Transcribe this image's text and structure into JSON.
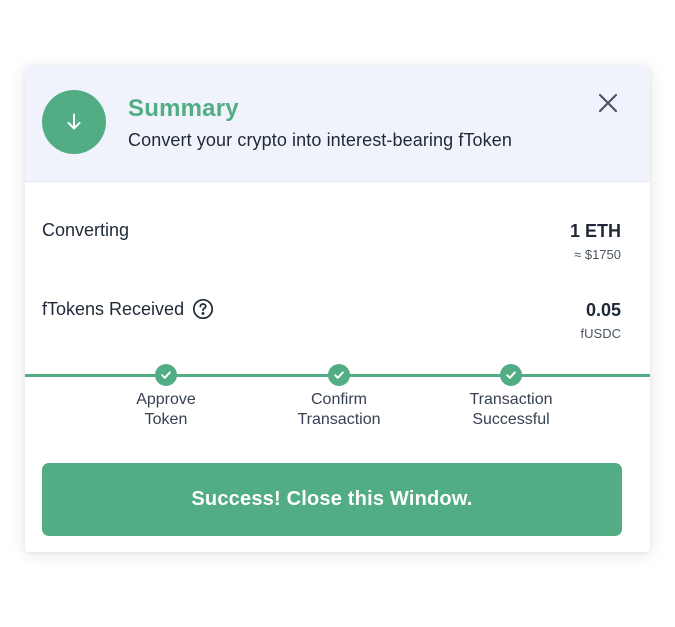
{
  "header": {
    "icon": "arrow-down-icon",
    "title": "Summary",
    "subtitle": "Convert your crypto into interest-bearing fToken",
    "close_icon": "close-icon"
  },
  "converting": {
    "label": "Converting",
    "amount": "1 ETH",
    "usd_value": "≈ $1750"
  },
  "received": {
    "label": "fTokens Received",
    "help_icon": "question-circle-icon",
    "amount": "0.05",
    "token": "fUSDC"
  },
  "steps": [
    {
      "line1": "Approve",
      "line2": "Token",
      "status": "complete"
    },
    {
      "line1": "Confirm",
      "line2": "Transaction",
      "status": "complete"
    },
    {
      "line1": "Transaction",
      "line2": "Successful",
      "status": "complete"
    }
  ],
  "action_button": {
    "label": "Success! Close this Window."
  },
  "colors": {
    "accent": "#52ad84",
    "header_bg": "#f0f3fb",
    "text": "#1f2937"
  }
}
